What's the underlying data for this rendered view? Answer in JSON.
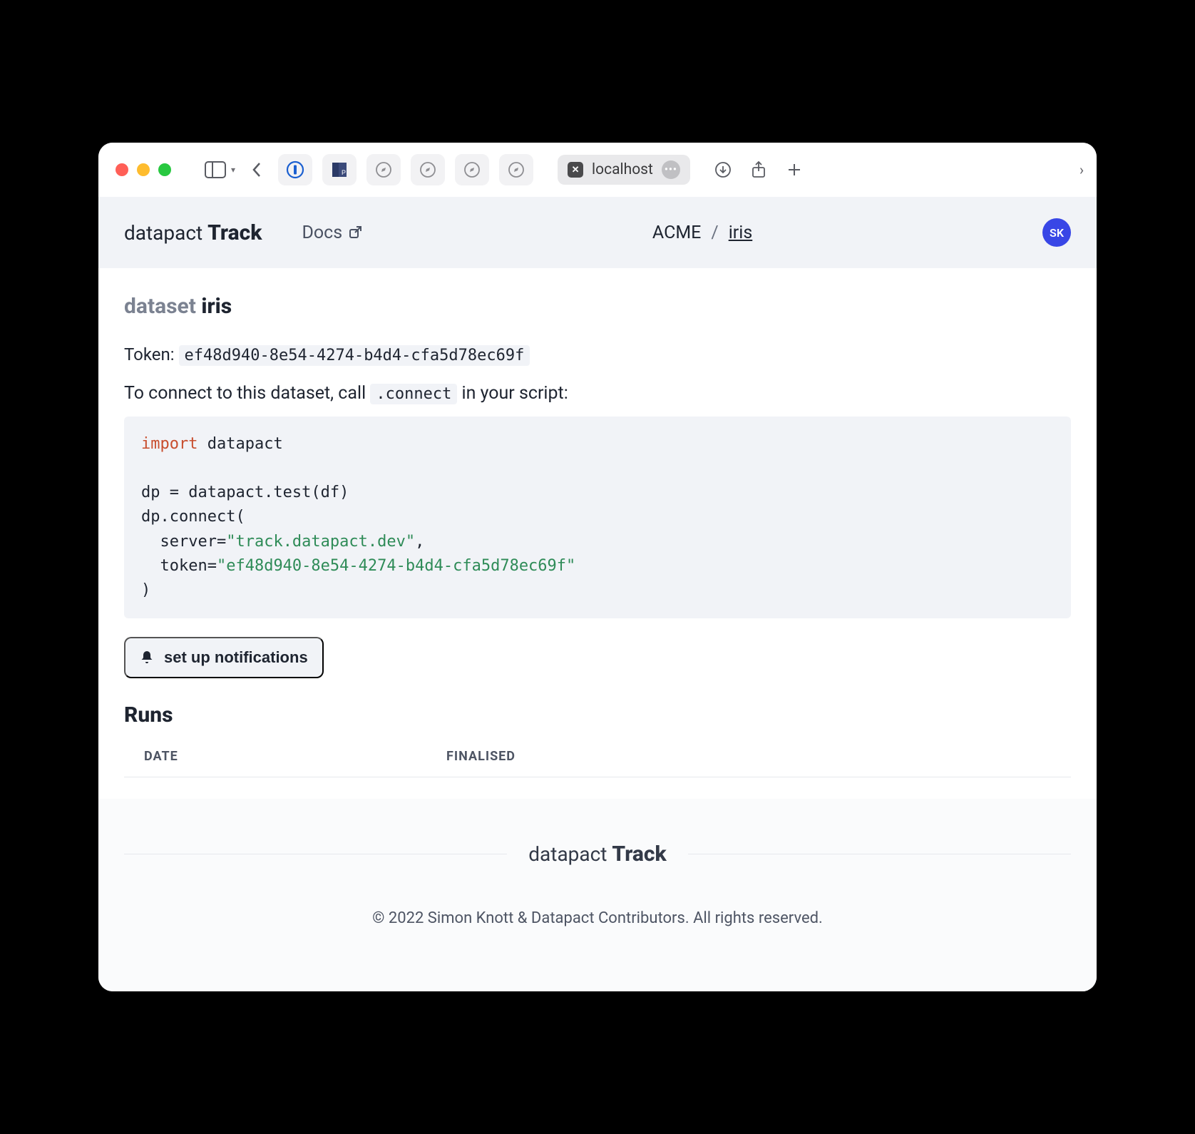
{
  "browser": {
    "address": "localhost"
  },
  "brand": {
    "light": "datapact",
    "bold": "Track"
  },
  "nav": {
    "docs_label": "Docs"
  },
  "breadcrumb": {
    "org": "ACME",
    "sep": "/",
    "dataset": "iris"
  },
  "avatar_initials": "SK",
  "page": {
    "heading_prefix": "dataset",
    "dataset_name": "iris",
    "token_label": "Token:",
    "token_value": "ef48d940-8e54-4274-b4d4-cfa5d78ec69f",
    "connect_prompt_pre": "To connect to this dataset, call ",
    "connect_inline": ".connect",
    "connect_prompt_post": " in your script:",
    "code": {
      "l1_kw": "import",
      "l1_rest": " datapact",
      "l3": "dp = datapact.test(df)",
      "l4": "dp.connect(",
      "l5_pre": "  server=",
      "l5_str": "\"track.datapact.dev\"",
      "l5_post": ",",
      "l6_pre": "  token=",
      "l6_str": "\"ef48d940-8e54-4274-b4d4-cfa5d78ec69f\"",
      "l7": ")"
    }
  },
  "notif_button": "set up notifications",
  "runs": {
    "title": "Runs",
    "col_date": "DATE",
    "col_finalised": "FINALISED"
  },
  "footer": {
    "brand_light": "datapact",
    "brand_bold": "Track",
    "copyright": "© 2022 Simon Knott & Datapact Contributors. All rights reserved."
  }
}
